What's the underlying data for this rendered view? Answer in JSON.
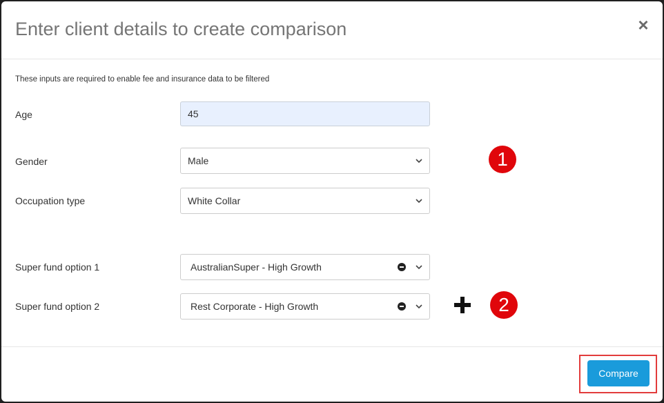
{
  "modal": {
    "title": "Enter client details to create comparison",
    "close_glyph": "×",
    "note": "These inputs are required to enable fee and insurance data to be filtered"
  },
  "form": {
    "age": {
      "label": "Age",
      "value": "45"
    },
    "gender": {
      "label": "Gender",
      "value": "Male"
    },
    "occupation": {
      "label": "Occupation type",
      "value": "White Collar"
    },
    "fund1": {
      "label": "Super fund option 1",
      "value": "AustralianSuper - High Growth"
    },
    "fund2": {
      "label": "Super fund option 2",
      "value": "Rest Corporate - High Growth"
    }
  },
  "annotations": {
    "badge1": "1",
    "badge2": "2"
  },
  "footer": {
    "compare_label": "Compare"
  },
  "colors": {
    "badge": "#e0060b",
    "primary_button": "#1a9bdb",
    "highlight_border": "#e23b3b",
    "autofill_bg": "#e8f0fe"
  },
  "icons": {
    "close": "close-icon",
    "dropdown": "chevron-down-icon",
    "remove": "minus-circle-icon",
    "add": "plus-icon"
  }
}
